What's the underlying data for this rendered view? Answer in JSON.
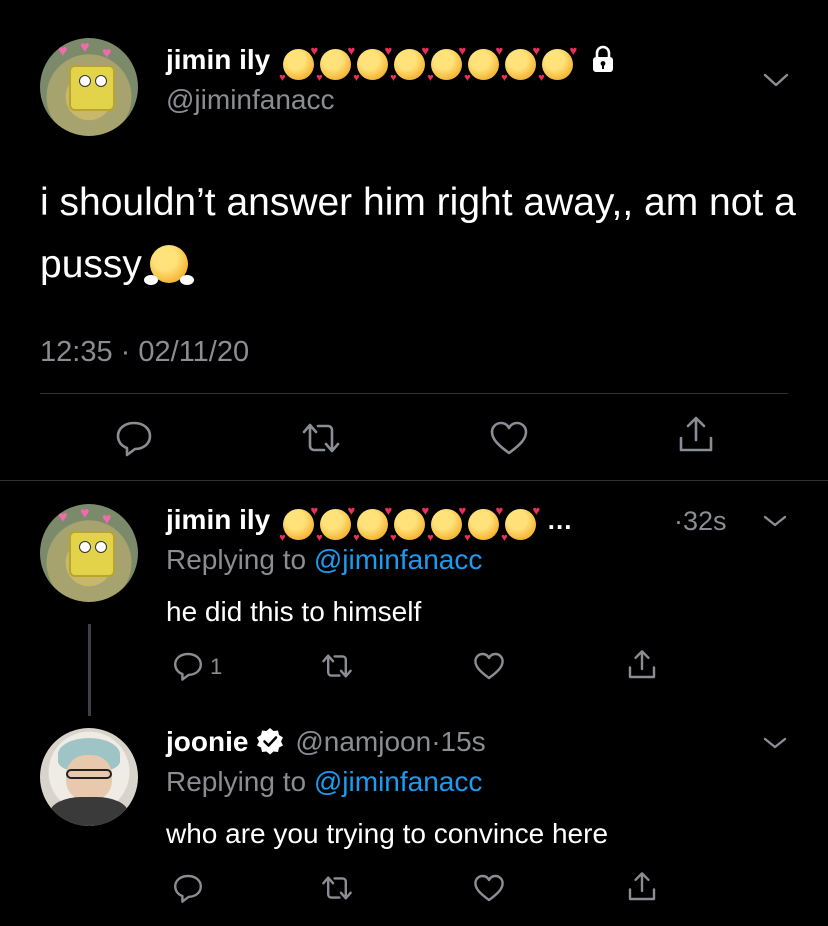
{
  "main_tweet": {
    "display_name": "jimin ily",
    "handle": "@jiminfanacc",
    "text": "i shouldn’t answer him right away,, am not a pussy",
    "time": "12:35",
    "separator": "·",
    "date": "02/11/20"
  },
  "reply1": {
    "display_name": "jimin ily",
    "ellipsis": "…",
    "time": "·32s",
    "replying_prefix": "Replying to",
    "replying_handle": "@jiminfanacc",
    "text": "he did this to himself",
    "reply_count": "1"
  },
  "reply2": {
    "display_name": "joonie",
    "handle": "@namjoon",
    "time": "·15s",
    "replying_prefix": "Replying to",
    "replying_handle": "@jiminfanacc",
    "text": "who are you trying to convince here"
  },
  "icons": {
    "reply": "reply-icon",
    "retweet": "retweet-icon",
    "like": "heart-icon",
    "share": "share-icon",
    "lock": "lock-icon",
    "chevron": "chevron-down-icon",
    "verified": "verified-icon"
  },
  "colors": {
    "background": "#000000",
    "text": "#ffffff",
    "secondary": "#8a8d91",
    "link": "#1d9bf0"
  }
}
